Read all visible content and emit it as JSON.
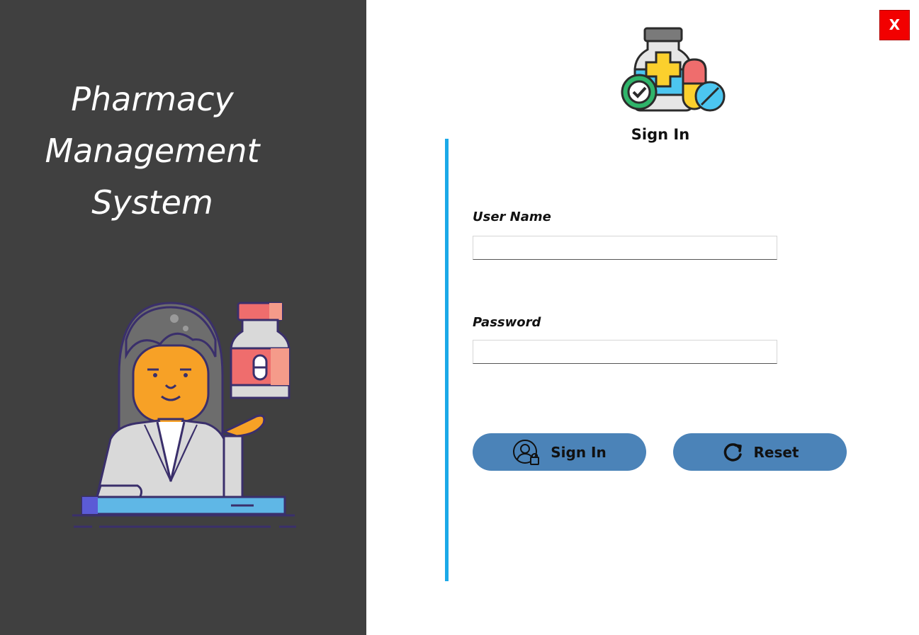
{
  "window": {
    "close_label": "X"
  },
  "left_panel": {
    "title_lines": [
      "Pharmacy",
      "Management",
      "System"
    ],
    "illustration": "pharmacist-with-medicine-bottle"
  },
  "form": {
    "logo_icon": "medicine-bottle-pills-icon",
    "heading": "Sign In",
    "username_label": "User Name",
    "username_value": "",
    "password_label": "Password",
    "password_value": ""
  },
  "buttons": {
    "sign_in_label": "Sign In",
    "sign_in_icon": "user-lock-icon",
    "reset_label": "Reset",
    "reset_icon": "refresh-icon"
  },
  "colors": {
    "left_panel_bg": "#404040",
    "accent_line": "#1ba9e8",
    "button_bg": "#4b83b8",
    "close_button_bg": "#f20000"
  }
}
